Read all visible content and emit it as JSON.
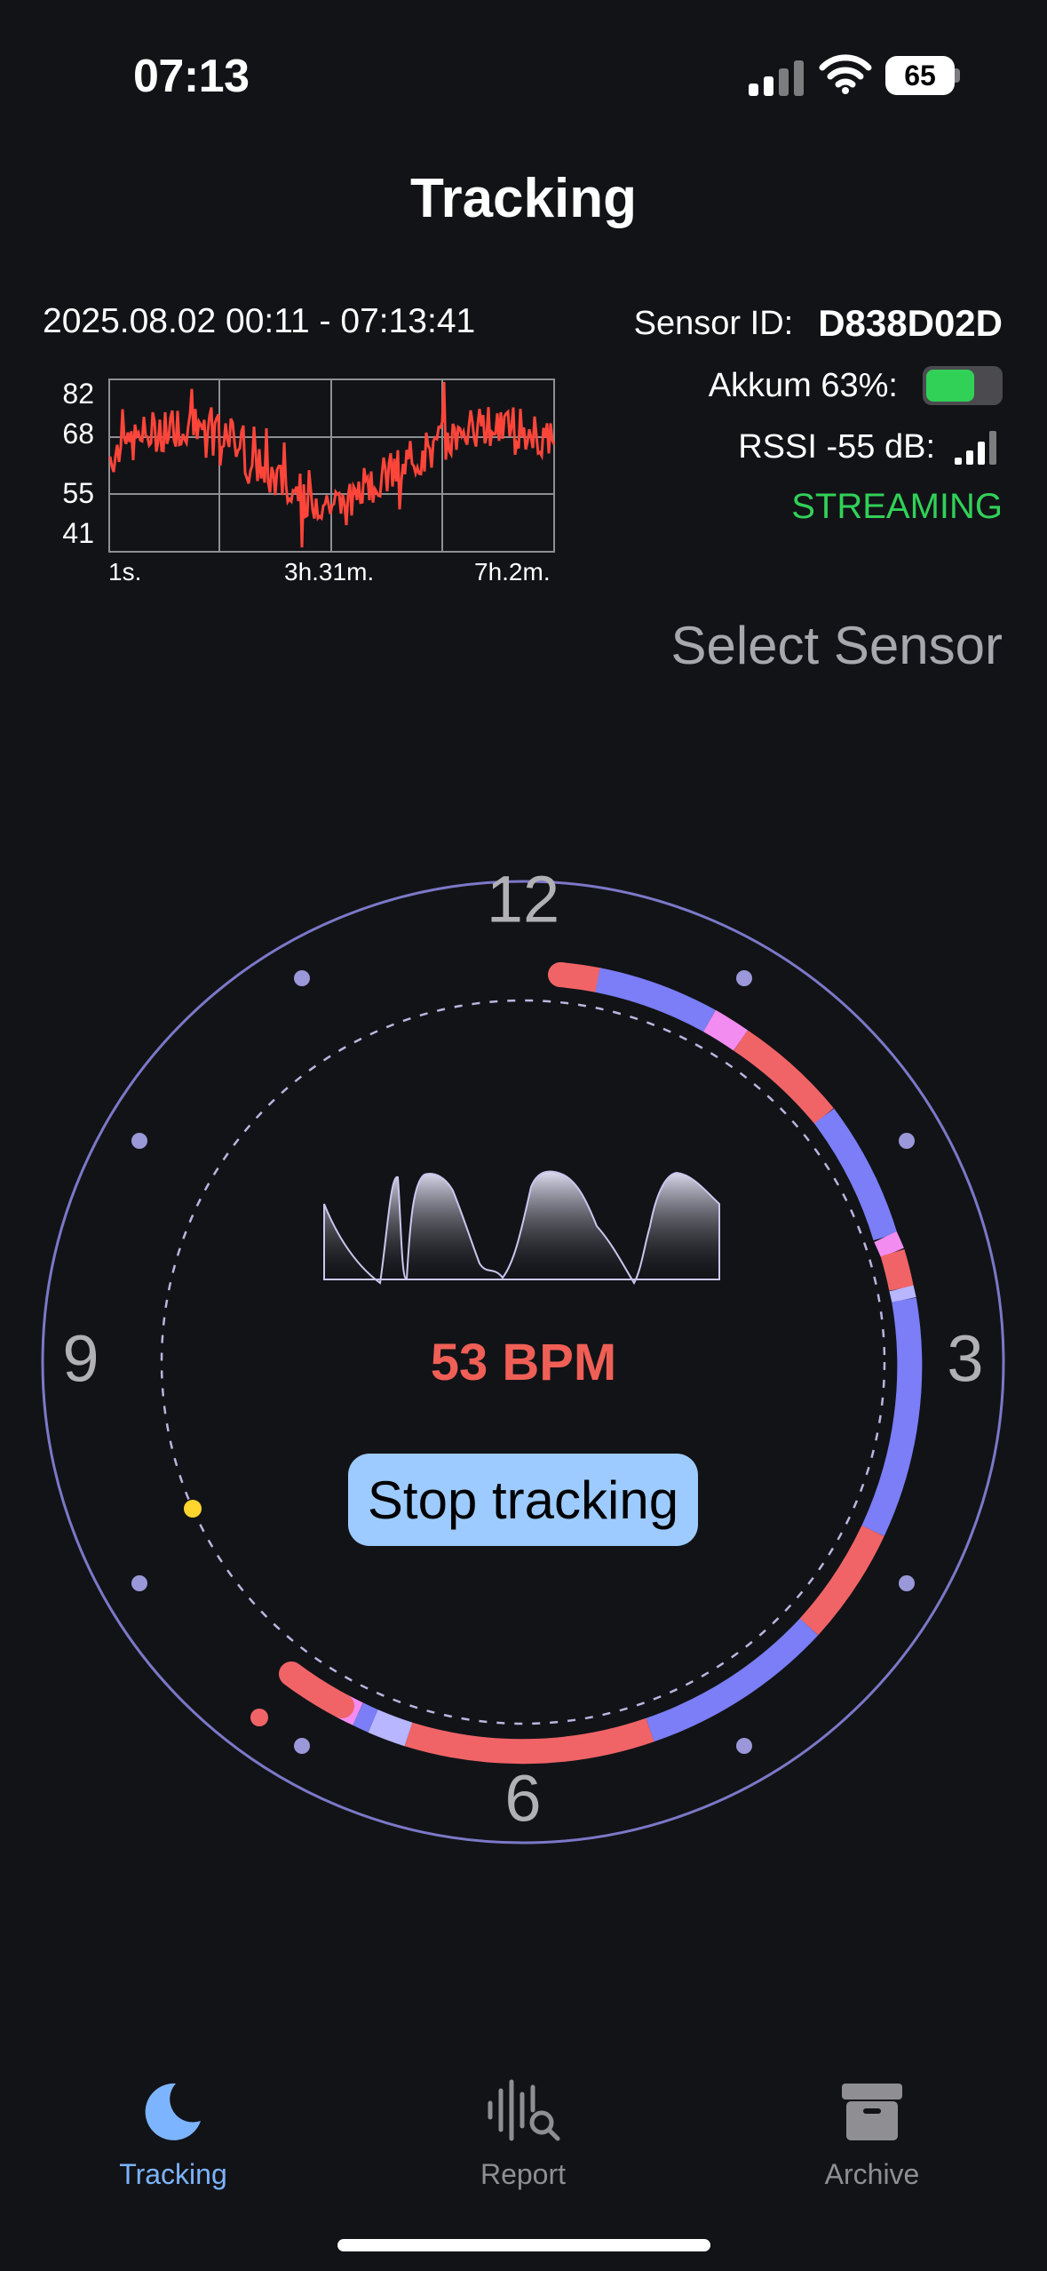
{
  "status_bar": {
    "time": "07:13",
    "battery": "65"
  },
  "header": {
    "title": "Tracking"
  },
  "summary": {
    "range": "2025.08.02 00:11 - 07:13:41",
    "sparkline": {
      "y_ticks": [
        "82",
        "68",
        "55",
        "41"
      ],
      "x_ticks": [
        "1s.",
        "3h.31m.",
        "7h.2m."
      ],
      "line_color": "#ff453a"
    }
  },
  "sensor": {
    "id_label": "Sensor ID:",
    "id_value": "D838D02D",
    "akkum_label": "Akkum 63%:",
    "akkum_level": 0.63,
    "rssi_label": "RSSI -55 dB:",
    "status": "STREAMING",
    "select_label": "Select Sensor"
  },
  "dial": {
    "numbers": {
      "top": "12",
      "right": "3",
      "bottom": "6",
      "left": "9"
    },
    "bpm": "53 BPM",
    "stop_label": "Stop tracking"
  },
  "tabs": [
    {
      "label": "Tracking",
      "icon": "moon-icon",
      "active": true
    },
    {
      "label": "Report",
      "icon": "waveform-search-icon",
      "active": false
    },
    {
      "label": "Archive",
      "icon": "archive-box-icon",
      "active": false
    }
  ],
  "colors": {
    "background": "#121317",
    "accent": "#9ecbff",
    "bpm": "#f05f56",
    "streaming": "#31d158",
    "ring_deep": "#7b7ef6",
    "ring_light": "#f06467",
    "ring_rem": "#f28cf0",
    "ring_awake": "#b7b6ff"
  }
}
